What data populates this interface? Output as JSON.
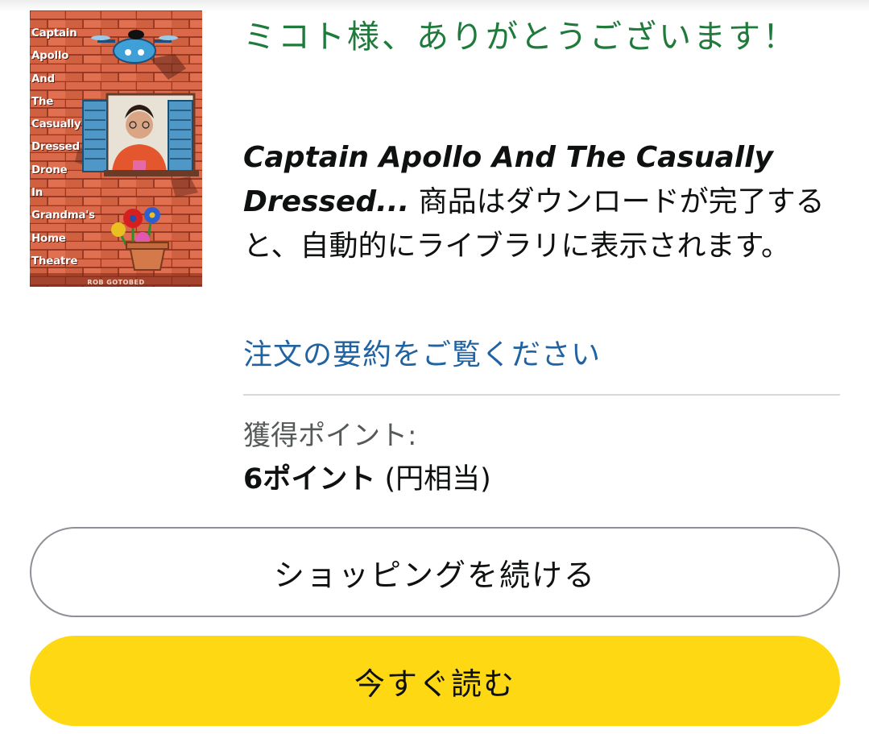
{
  "cover": {
    "title_lines": [
      "Captain",
      "Apollo",
      "And",
      "The",
      "Casually",
      "Dressed",
      "Drone",
      "In",
      "Grandma's",
      "Home",
      "Theatre"
    ],
    "author": "ROB GOTOBED"
  },
  "thanks_message": "ミコト様、ありがとうございます！",
  "delivery": {
    "book_title": "Captain Apollo And The Casually Dressed...",
    "message": " 商品はダウンロードが完了すると、自動的にライブラリに表示されます。"
  },
  "order_summary_link": "注文の要約をご覧ください",
  "points": {
    "label": "獲得ポイント:",
    "value": "6ポイント",
    "note": " (円相当)"
  },
  "buttons": {
    "continue_shopping": "ショッピングを続ける",
    "read_now": "今すぐ読む"
  },
  "colors": {
    "thanks_green": "#1f7a3c",
    "link_blue": "#2162a1",
    "read_button_yellow": "#ffd814",
    "text_dark": "#0f1111",
    "text_muted": "#565959"
  }
}
